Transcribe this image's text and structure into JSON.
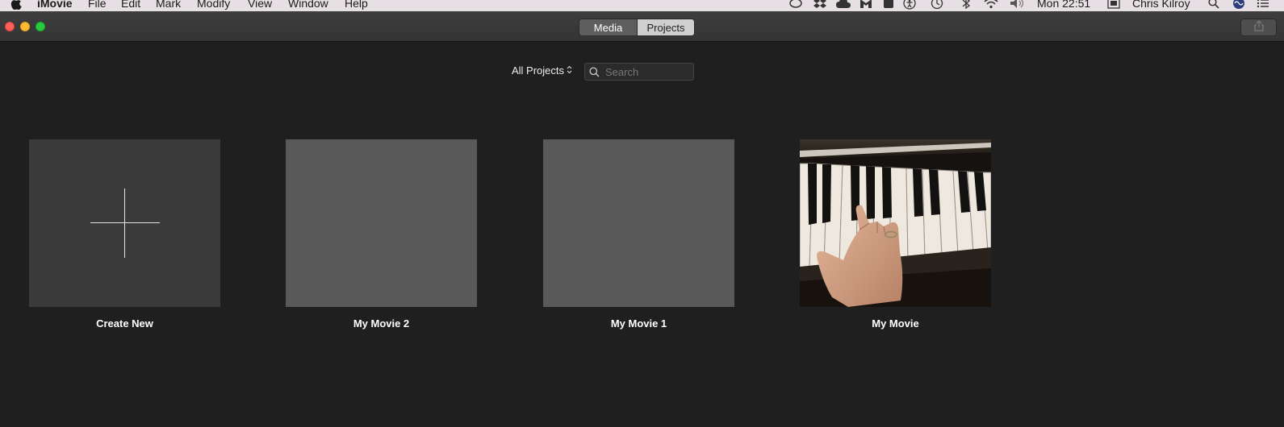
{
  "menubar": {
    "app_name": "iMovie",
    "items": [
      "File",
      "Edit",
      "Mark",
      "Modify",
      "View",
      "Window",
      "Help"
    ],
    "clock": "Mon 22:51",
    "user": "Chris Kilroy"
  },
  "toolbar": {
    "tabs": [
      {
        "label": "Media",
        "active": false
      },
      {
        "label": "Projects",
        "active": true
      }
    ]
  },
  "filter": {
    "label": "All Projects",
    "search_placeholder": "Search"
  },
  "projects": [
    {
      "label": "Create New",
      "kind": "create"
    },
    {
      "label": "My Movie 2",
      "kind": "blank"
    },
    {
      "label": "My Movie 1",
      "kind": "blank"
    },
    {
      "label": "My Movie",
      "kind": "piano-video"
    }
  ],
  "colors": {
    "window_bg": "#1f1f1f",
    "create_tile": "#3a3a3a",
    "blank_tile": "#595959"
  }
}
